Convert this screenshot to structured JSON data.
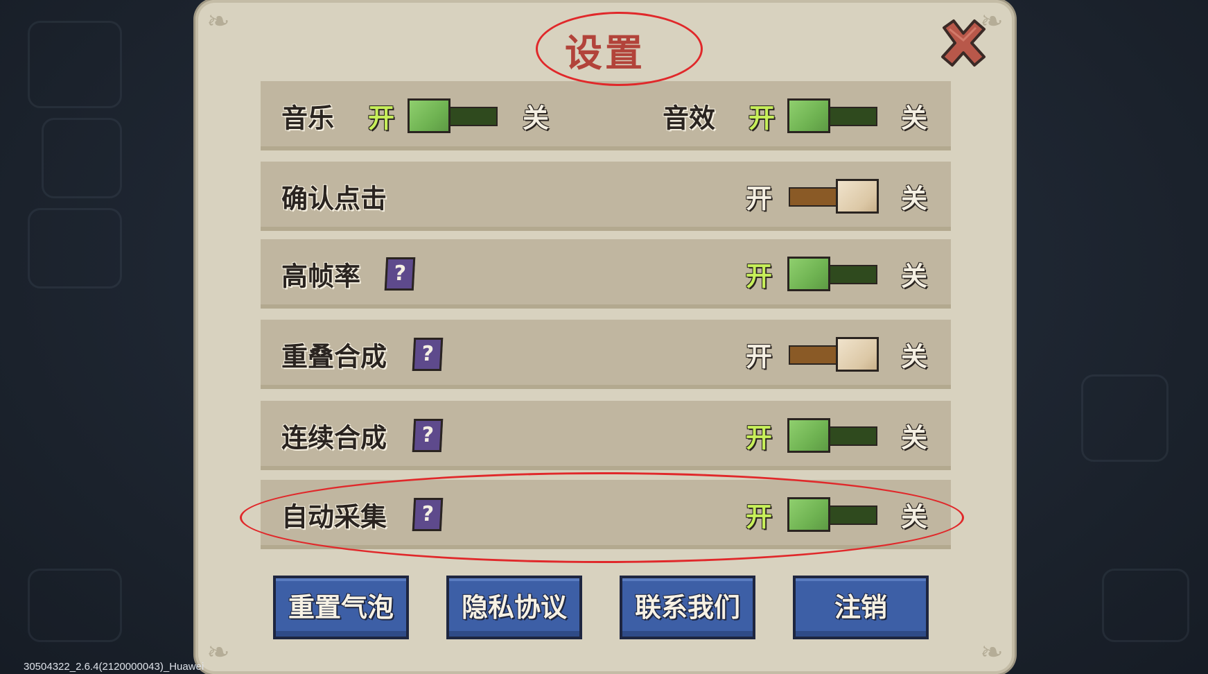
{
  "dialog": {
    "title": "设置",
    "close_icon": "close-x-icon"
  },
  "rows": {
    "music": {
      "label": "音乐",
      "on": "开",
      "off": "关",
      "state": "on"
    },
    "sound": {
      "label": "音效",
      "on": "开",
      "off": "关",
      "state": "on"
    },
    "confirm_click": {
      "label": "确认点击",
      "on": "开",
      "off": "关",
      "state": "off"
    },
    "high_framerate": {
      "label": "高帧率",
      "help": "?",
      "on": "开",
      "off": "关",
      "state": "on"
    },
    "stack_merge": {
      "label": "重叠合成",
      "help": "?",
      "on": "开",
      "off": "关",
      "state": "off"
    },
    "continuous_merge": {
      "label": "连续合成",
      "help": "?",
      "on": "开",
      "off": "关",
      "state": "on"
    },
    "auto_collect": {
      "label": "自动采集",
      "help": "?",
      "on": "开",
      "off": "关",
      "state": "on"
    }
  },
  "buttons": {
    "reset_bubbles": "重置气泡",
    "privacy_policy": "隐私协议",
    "contact_us": "联系我们",
    "logout": "注销"
  },
  "footer": {
    "version": "30504322_2.6.4(2120000043)_Huawei"
  },
  "colors": {
    "title": "#b2433a",
    "highlight_circle": "#e0282a",
    "on_active": "#c7ef5a",
    "button_blue": "#3d5fa6"
  }
}
